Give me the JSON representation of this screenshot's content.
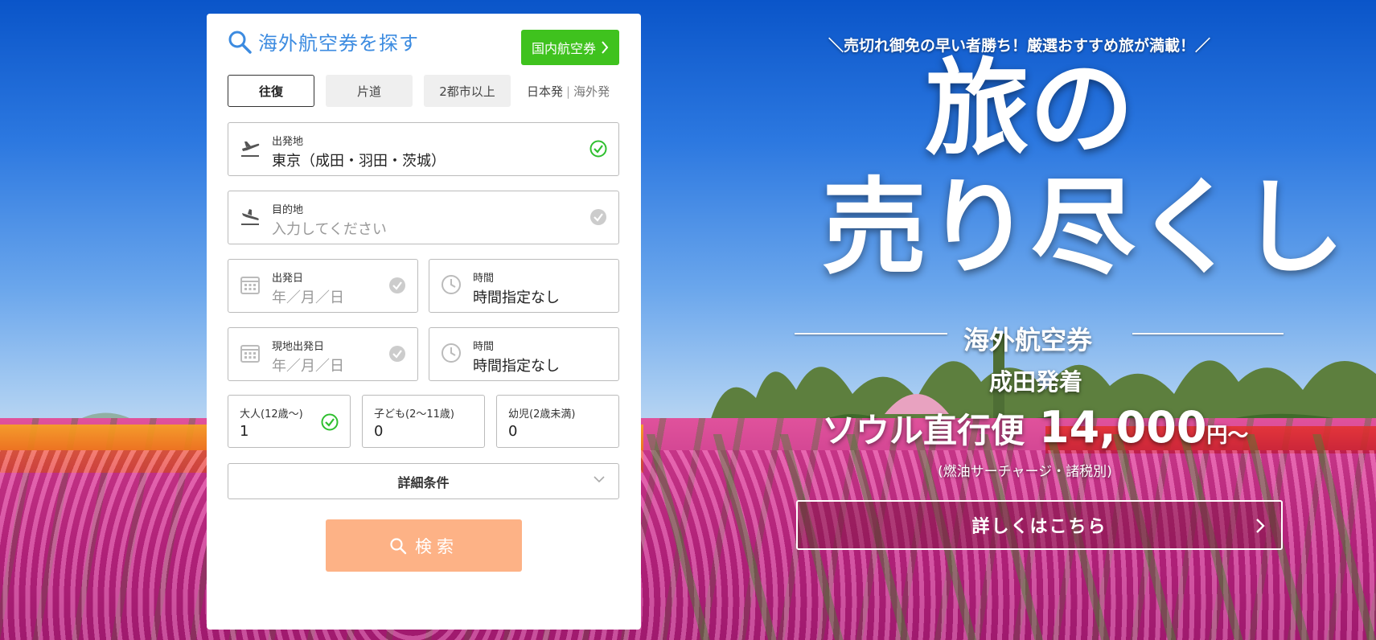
{
  "panel": {
    "title": "海外航空券を探す",
    "domestic_button": "国内航空券",
    "trip_tabs": [
      "往復",
      "片道",
      "2都市以上"
    ],
    "origin_switch": {
      "japan": "日本発",
      "overseas": "海外発"
    },
    "departure": {
      "label": "出発地",
      "value": "東京（成田・羽田・茨城）"
    },
    "destination": {
      "label": "目的地",
      "placeholder": "入力してください"
    },
    "depart_date": {
      "label": "出発日",
      "placeholder": "年／月／日"
    },
    "depart_time": {
      "label": "時間",
      "value": "時間指定なし"
    },
    "return_date": {
      "label": "現地出発日",
      "placeholder": "年／月／日"
    },
    "return_time": {
      "label": "時間",
      "value": "時間指定なし"
    },
    "adult": {
      "label": "大人(12歳～)",
      "value": "1"
    },
    "child": {
      "label": "子ども(2～11歳)",
      "value": "0"
    },
    "infant": {
      "label": "幼児(2歳未満)",
      "value": "0"
    },
    "detail_label": "詳細条件",
    "search_label": "検索"
  },
  "promo": {
    "tagline": "＼売切れ御免の早い者勝ち！厳選おすすめ旅が満載！／",
    "headline_1": "旅の",
    "headline_2": "売り尽くし",
    "category": "海外航空券",
    "route": "成田発着",
    "destination": "ソウル直行便",
    "price": "14,000",
    "price_suffix": "円～",
    "note": "(燃油サーチャージ・諸税別)",
    "button_label": "詳しくはこちら"
  },
  "colors": {
    "accent_blue": "#3c8be0",
    "domestic_green": "#3fc21e",
    "search_orange": "#fdb286",
    "check_green": "#2fbf2f",
    "check_gray": "#cccccc"
  },
  "icons": [
    "search-icon",
    "chevron-right-icon",
    "takeoff-icon",
    "landing-icon",
    "calendar-icon",
    "clock-icon",
    "check-circle-icon",
    "chevron-down-icon"
  ]
}
